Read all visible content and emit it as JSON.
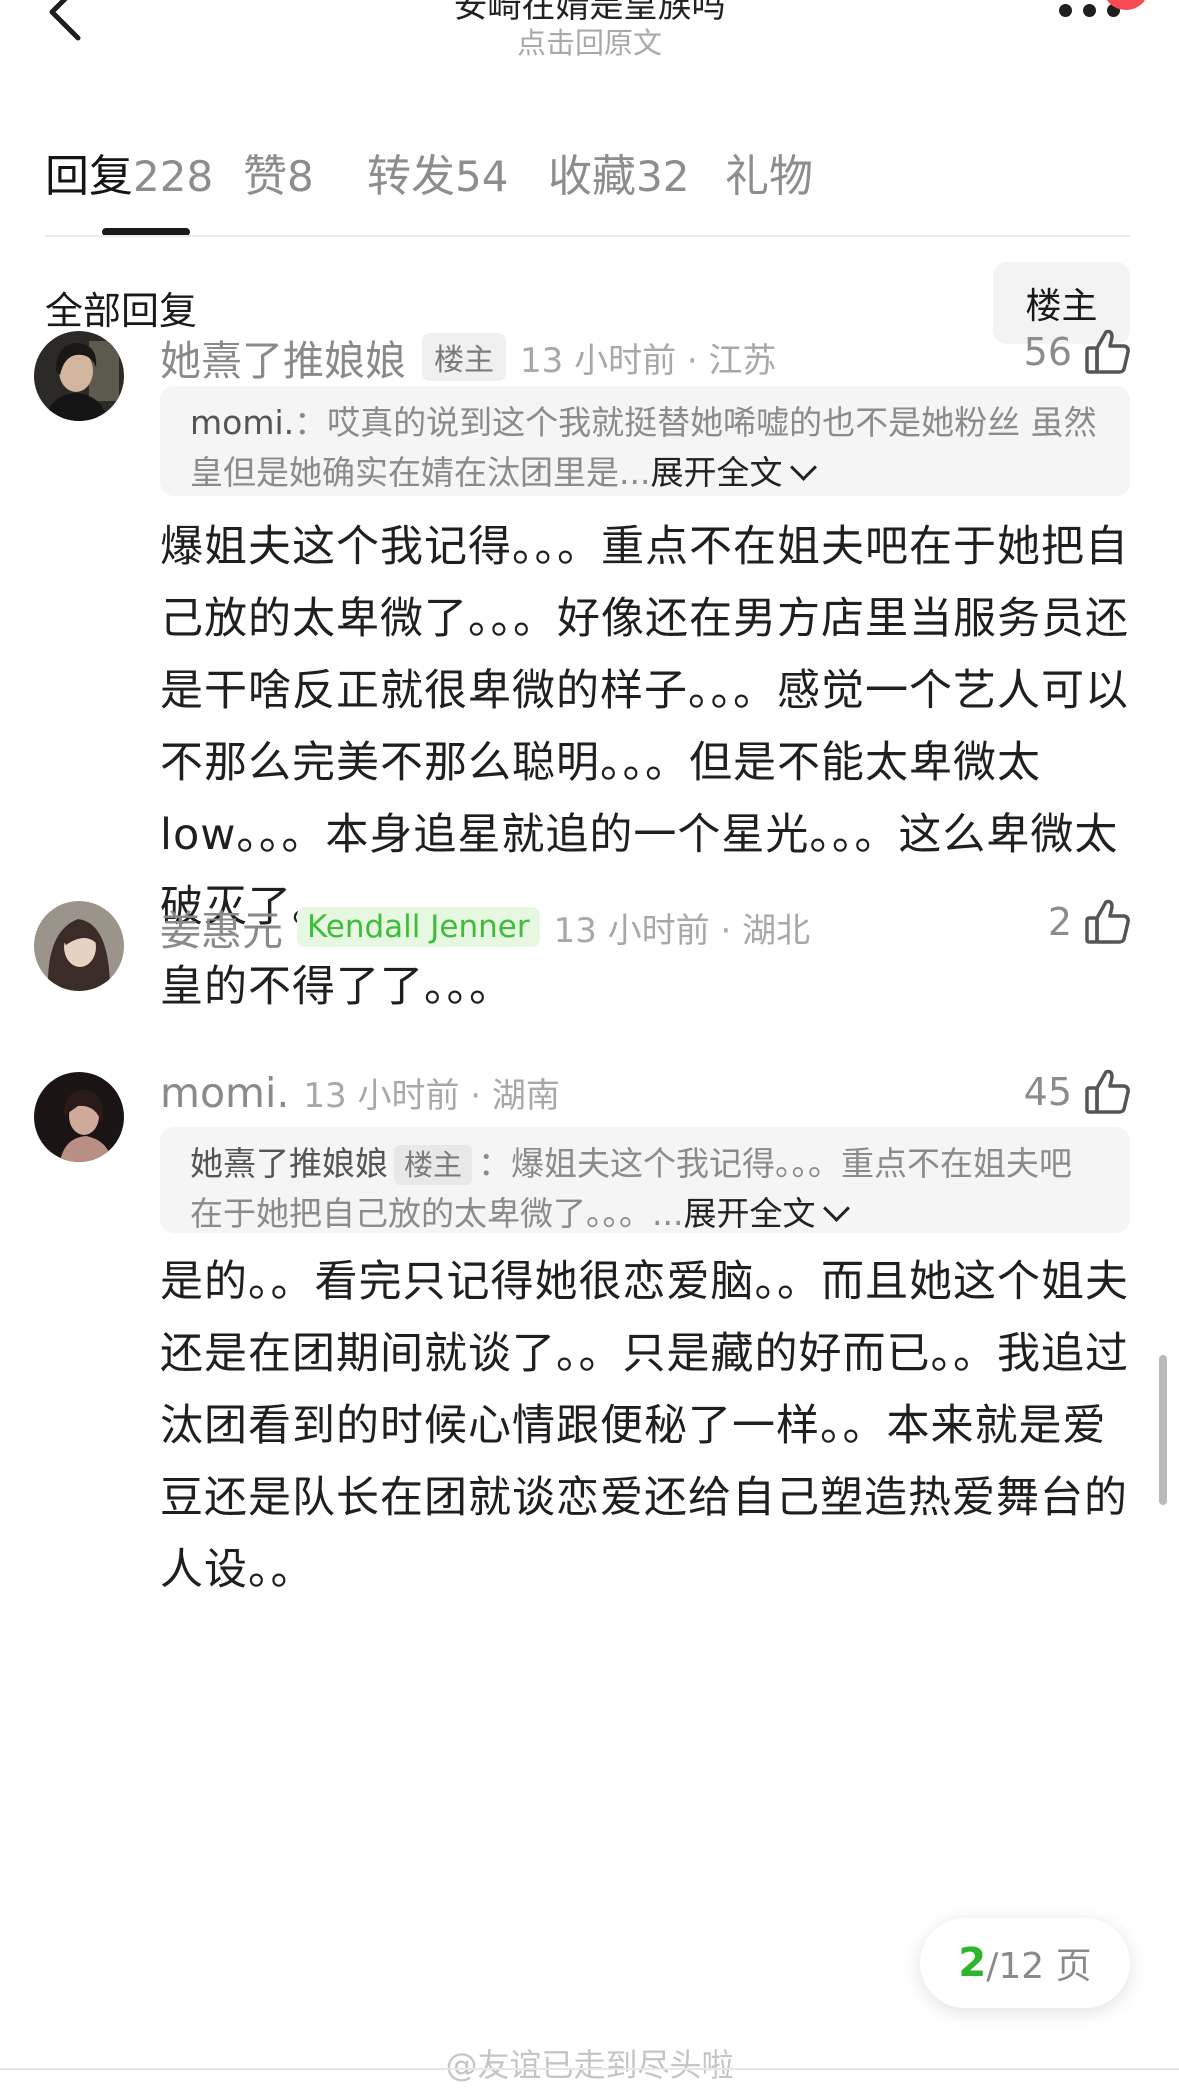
{
  "header": {
    "title": "安崎在婧是皇族吗",
    "subtitle": "点击回原文"
  },
  "tabs": [
    {
      "label": "回复",
      "count": "228"
    },
    {
      "label": "赞",
      "count": "8"
    },
    {
      "label": "转发",
      "count": "54"
    },
    {
      "label": "收藏",
      "count": "32"
    },
    {
      "label": "礼物",
      "count": ""
    }
  ],
  "filter": {
    "all_replies": "全部回复",
    "owner_button": "楼主"
  },
  "comments": [
    {
      "username": "她熹了推娘娘",
      "badge": "楼主",
      "time": "13 小时前 · 江苏",
      "likes": "56",
      "quote": {
        "author": "momi.",
        "sep": "：",
        "text": "哎真的说到这个我就挺替她唏嘘的也不是她粉丝 虽然皇但是她确实在婧在汰团里是...",
        "expand": "展开全文"
      },
      "body": "爆姐夫这个我记得。。。重点不在姐夫吧在于她把自己放的太卑微了。。。好像还在男方店里当服务员还是干啥反正就很卑微的样子。。。感觉一个艺人可以不那么完美不那么聪明。。。但是不能太卑微太low。。。本身追星就追的一个星光。。。这么卑微太破灭了。。。"
    },
    {
      "username": "姜惠元",
      "badge": "Kendall Jenner",
      "time": "13 小时前 · 湖北",
      "likes": "2",
      "body": "皇的不得了了。。。"
    },
    {
      "username": "momi.",
      "time": "13 小时前 · 湖南",
      "likes": "45",
      "quote": {
        "author": "她熹了推娘娘",
        "tag": "楼主",
        "sep": "：",
        "text": "爆姐夫这个我记得。。。重点不在姐夫吧在于她把自己放的太卑微了。。。...",
        "expand": "展开全文"
      },
      "body": "是的。。看完只记得她很恋爱脑。。而且她这个姐夫还是在团期间就谈了。。只是藏的好而已。。我追过汰团看到的时候心情跟便秘了一样。。本来就是爱豆还是队长在团就谈恋爱还给自己塑造热爱舞台的人设。。"
    }
  ],
  "pager": {
    "current": "2",
    "total": "/12 页"
  },
  "watermark": "@友谊已走到尽头啦",
  "colors": {
    "accent_green": "#2fb52a",
    "badge_green_bg": "#e6f8e1",
    "notification_red": "#fb4b52"
  }
}
